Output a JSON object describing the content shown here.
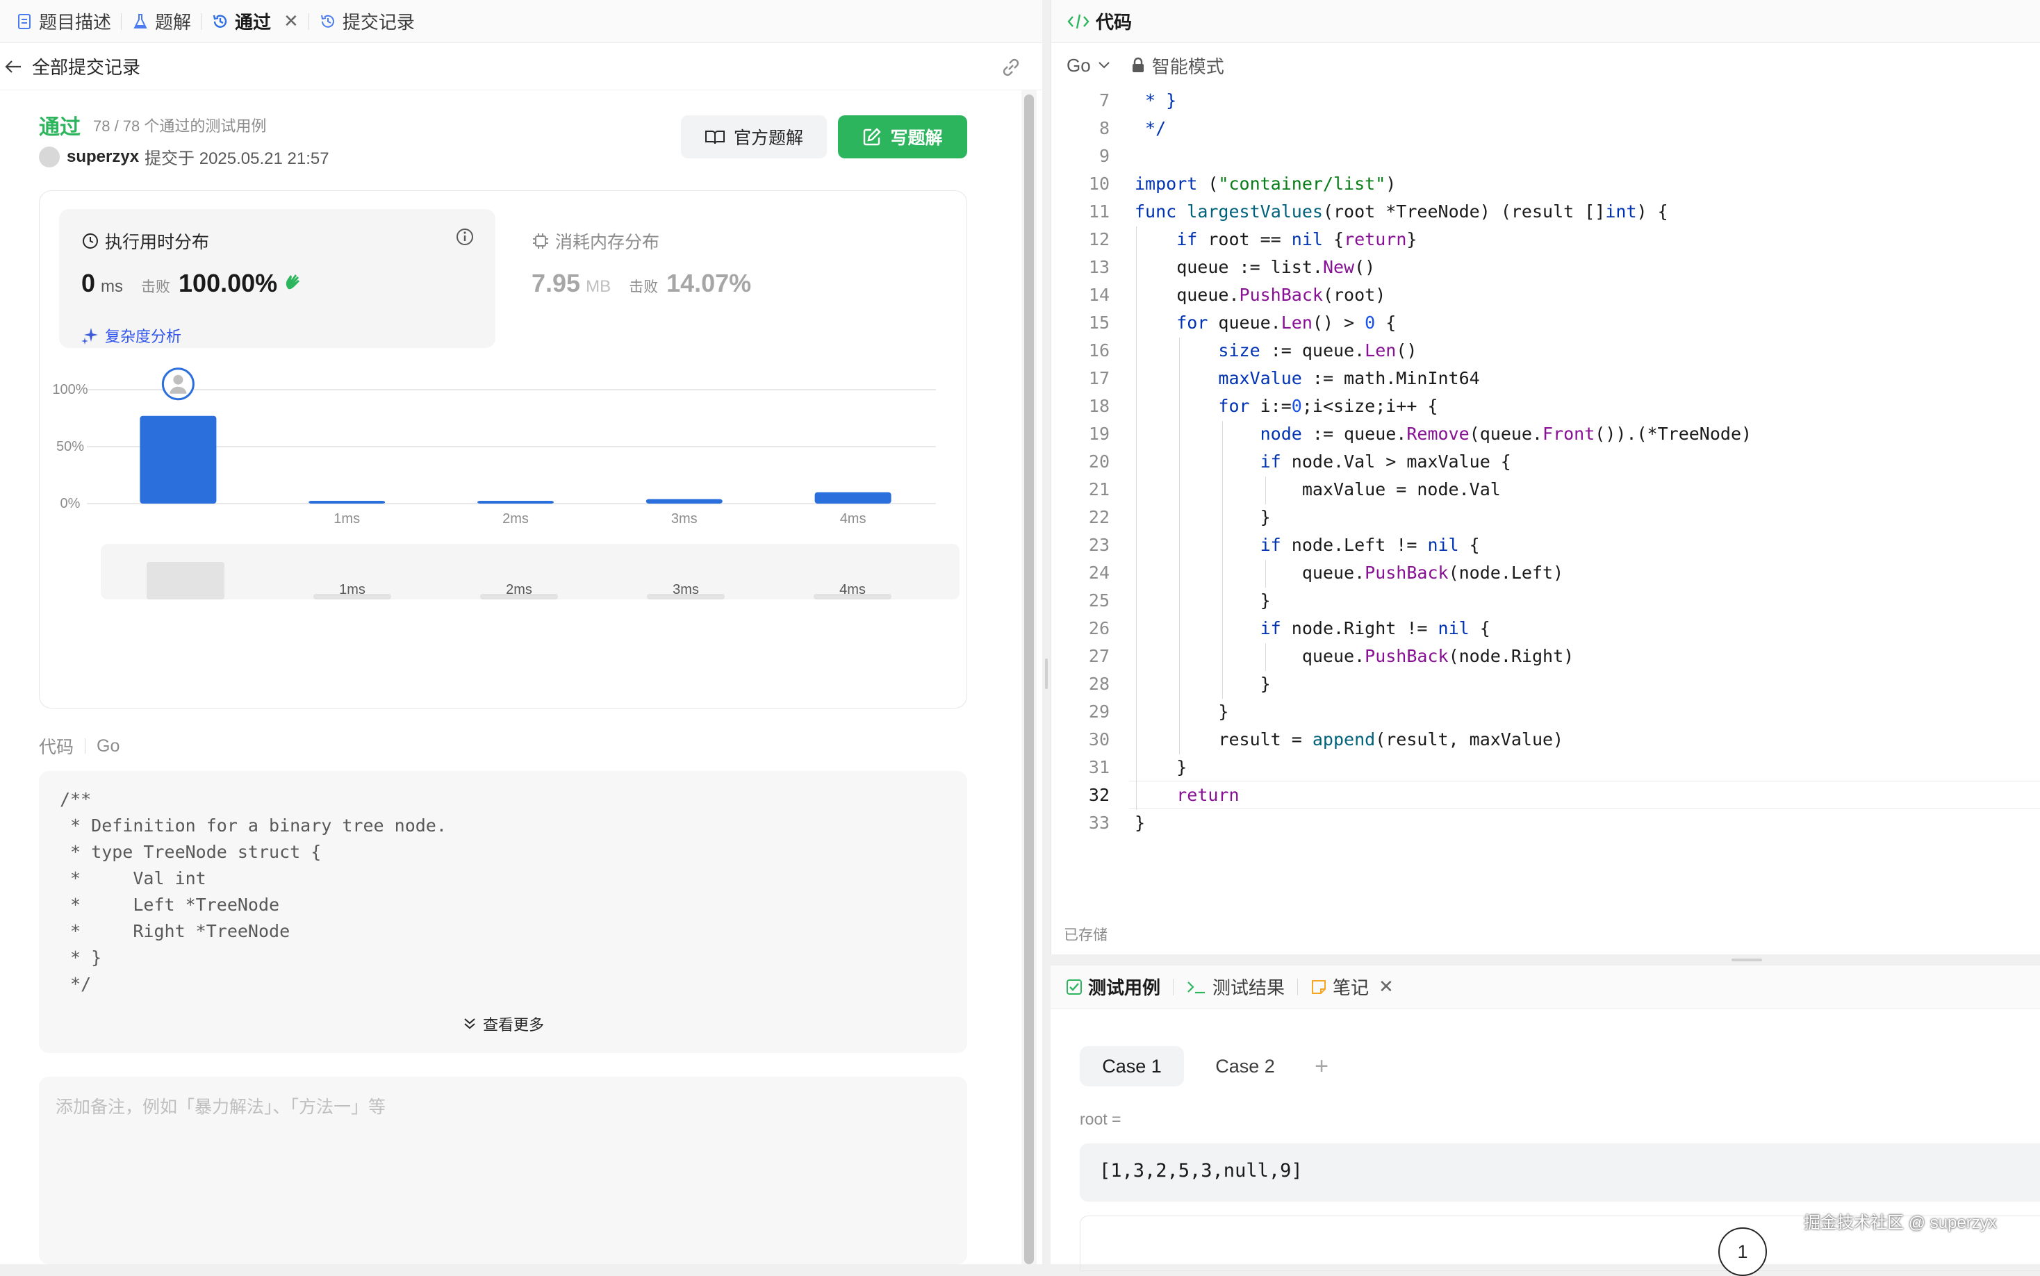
{
  "left_tabs": [
    {
      "label": "题目描述",
      "icon": "document-icon",
      "active": false
    },
    {
      "label": "题解",
      "icon": "flask-icon",
      "active": false
    },
    {
      "label": "通过",
      "icon": "history-icon",
      "active": true,
      "closable": true
    },
    {
      "label": "提交记录",
      "icon": "history-icon",
      "active": false
    }
  ],
  "subheader": {
    "title": "全部提交记录"
  },
  "submission": {
    "status": "通过",
    "cases": "78 / 78 个通过的测试用例",
    "user": "superzyx",
    "submitted_at": "提交于 2025.05.21 21:57",
    "official_btn": "官方题解",
    "write_btn": "写题解"
  },
  "runtime": {
    "title": "执行用时分布",
    "value": "0",
    "unit": "ms",
    "beat_label": "击败",
    "beat": "100.00%",
    "complexity": "复杂度分析"
  },
  "memory": {
    "title": "消耗内存分布",
    "value": "7.95",
    "unit": "MB",
    "beat_label": "击败",
    "beat": "14.07%"
  },
  "chart_data": {
    "type": "bar",
    "categories": [
      "0ms",
      "1ms",
      "2ms",
      "3ms",
      "4ms"
    ],
    "x_tick_labels": [
      "",
      "1ms",
      "2ms",
      "3ms",
      "4ms"
    ],
    "values": [
      77,
      2,
      2,
      4,
      10
    ],
    "ytick_labels": [
      "100%",
      "50%",
      "0%"
    ],
    "ylim": [
      0,
      100
    ],
    "highlight_index": 0,
    "grid": true,
    "minimap_labels": [
      "1ms",
      "2ms",
      "3ms",
      "4ms"
    ],
    "bar_color": "#2a6fdb"
  },
  "code_section": {
    "label": "代码",
    "lang": "Go",
    "preview_lines": [
      "/**",
      " * Definition for a binary tree node.",
      " * type TreeNode struct {",
      " *     Val int",
      " *     Left *TreeNode",
      " *     Right *TreeNode",
      " * }",
      " */"
    ],
    "more": "查看更多",
    "note_placeholder": "添加备注，例如「暴力解法」、「方法一」等"
  },
  "editor": {
    "title": "代码",
    "lang": "Go",
    "mode": "智能模式",
    "saved": "已存储",
    "current_line": 32,
    "lines": [
      {
        "n": 7,
        "t": " * }"
      },
      {
        "n": 8,
        "t": " */"
      },
      {
        "n": 9,
        "t": ""
      },
      {
        "n": 10,
        "t": "import (\"container/list\")"
      },
      {
        "n": 11,
        "t": "func largestValues(root *TreeNode) (result []int) {"
      },
      {
        "n": 12,
        "t": "    if root == nil {return}"
      },
      {
        "n": 13,
        "t": "    queue := list.New()"
      },
      {
        "n": 14,
        "t": "    queue.PushBack(root)"
      },
      {
        "n": 15,
        "t": "    for queue.Len() > 0 {"
      },
      {
        "n": 16,
        "t": "        size := queue.Len()"
      },
      {
        "n": 17,
        "t": "        maxValue := math.MinInt64"
      },
      {
        "n": 18,
        "t": "        for i:=0;i<size;i++ {"
      },
      {
        "n": 19,
        "t": "            node := queue.Remove(queue.Front()).(*TreeNode)"
      },
      {
        "n": 20,
        "t": "            if node.Val > maxValue {"
      },
      {
        "n": 21,
        "t": "                maxValue = node.Val"
      },
      {
        "n": 22,
        "t": "            }"
      },
      {
        "n": 23,
        "t": "            if node.Left != nil {"
      },
      {
        "n": 24,
        "t": "                queue.PushBack(node.Left)"
      },
      {
        "n": 25,
        "t": "            }"
      },
      {
        "n": 26,
        "t": "            if node.Right != nil {"
      },
      {
        "n": 27,
        "t": "                queue.PushBack(node.Right)"
      },
      {
        "n": 28,
        "t": "            }"
      },
      {
        "n": 29,
        "t": "        }"
      },
      {
        "n": 30,
        "t": "        result = append(result, maxValue)"
      },
      {
        "n": 31,
        "t": "    }"
      },
      {
        "n": 32,
        "t": "    return"
      },
      {
        "n": 33,
        "t": "}"
      }
    ]
  },
  "bottom_tabs": [
    {
      "label": "测试用例",
      "icon": "checkbox-icon",
      "active": true
    },
    {
      "label": "测试结果",
      "icon": "terminal-icon",
      "active": false
    },
    {
      "label": "笔记",
      "icon": "note-icon",
      "active": false,
      "closable": true
    }
  ],
  "testcases": {
    "tabs": [
      "Case 1",
      "Case 2"
    ],
    "add": "+",
    "param_label": "root =",
    "param_value": "[1,3,2,5,3,null,9]",
    "tree_root": "1"
  },
  "watermark": "掘金技术社区 @ superzyx",
  "colors": {
    "accent_green": "#2db55d",
    "accent_blue": "#2a6fdb"
  }
}
